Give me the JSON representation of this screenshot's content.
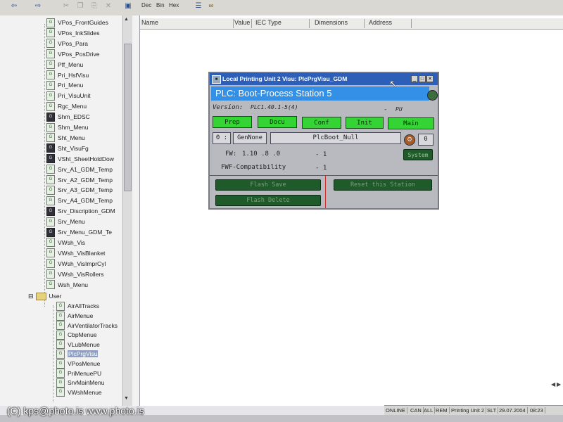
{
  "toolbar": {
    "dec": "Dec",
    "bin": "Bin",
    "hex": "Hex"
  },
  "tree": {
    "items": [
      {
        "label": "VPos_FrontGuides",
        "icon": "visu-icon"
      },
      {
        "label": "VPos_InkSlides",
        "icon": "visu-icon"
      },
      {
        "label": "VPos_Para",
        "icon": "visu-icon"
      },
      {
        "label": "VPos_PosDrive",
        "icon": "visu-icon"
      },
      {
        "label": "Pff_Menu",
        "icon": "visu-icon"
      },
      {
        "label": "Pri_HsfVisu",
        "icon": "visu-icon"
      },
      {
        "label": "Pri_Menu",
        "icon": "visu-icon"
      },
      {
        "label": "Pri_VisuUnit",
        "icon": "visu-icon"
      },
      {
        "label": "Rgc_Menu",
        "icon": "visu-icon"
      },
      {
        "label": "Shm_EDSC",
        "icon": "visu-dark-icon"
      },
      {
        "label": "Shm_Menu",
        "icon": "visu-icon"
      },
      {
        "label": "Sht_Menu",
        "icon": "visu-icon"
      },
      {
        "label": "Sht_VisuFg",
        "icon": "visu-dark-icon"
      },
      {
        "label": "VSht_SheetHoldDow",
        "icon": "visu-dark-icon"
      },
      {
        "label": "Srv_A1_GDM_Temp",
        "icon": "visu-icon"
      },
      {
        "label": "Srv_A2_GDM_Temp",
        "icon": "visu-icon"
      },
      {
        "label": "Srv_A3_GDM_Temp",
        "icon": "visu-icon"
      },
      {
        "label": "Srv_A4_GDM_Temp",
        "icon": "visu-icon"
      },
      {
        "label": "Srv_Discription_GDM",
        "icon": "visu-dark-icon"
      },
      {
        "label": "Srv_Menu",
        "icon": "visu-icon"
      },
      {
        "label": "Srv_Menu_GDM_Te",
        "icon": "visu-dark-icon"
      },
      {
        "label": "VWsh_Vis",
        "icon": "visu-icon"
      },
      {
        "label": "VWsh_VisBlanket",
        "icon": "visu-icon"
      },
      {
        "label": "VWsh_VisImprCyl",
        "icon": "visu-icon"
      },
      {
        "label": "VWsh_VisRollers",
        "icon": "visu-icon"
      },
      {
        "label": "Wsh_Menu",
        "icon": "visu-icon"
      }
    ],
    "folder": {
      "label": "User",
      "icon": "folder-icon"
    },
    "user_items": [
      {
        "label": "AirAllTracks"
      },
      {
        "label": "AirMenue"
      },
      {
        "label": "AirVentilatorTracks"
      },
      {
        "label": "CbpMenue"
      },
      {
        "label": "VLubMenue"
      },
      {
        "label": "PlcPrgVisu",
        "selected": true
      },
      {
        "label": "VPosMenue"
      },
      {
        "label": "PriMenuePU"
      },
      {
        "label": "SrvMainMenu"
      },
      {
        "label": "VWshMenue"
      }
    ]
  },
  "columns": {
    "name": "Name",
    "value": "Value",
    "iec_type": "IEC Type",
    "dimensions": "Dimensions",
    "address": "Address"
  },
  "dialog": {
    "title": "Local Printing Unit 2 Visu: PlcPrgVisu_GDM",
    "header": "PLC: Boot-Process  Station 5",
    "version_label": "Version:",
    "version_value": "PLC1.40.1-5(4)",
    "version_dash": "-",
    "version_suffix": "PU",
    "buttons": {
      "prep": "Prep",
      "docu": "Docu",
      "conf": "Conf",
      "init": "Init",
      "main": "Main"
    },
    "num_left": "0 :",
    "gen": "GenNone",
    "boot": "PlcBoot_Null",
    "num_right": "0",
    "fw_label": "FW:",
    "fw_value": "1.10  .8   .0",
    "fw_dash": "- 1",
    "fwf_label": "FWF-Compatibility",
    "fwf_dash": "- 1",
    "system_button": "System",
    "flash_save": "Flash Save",
    "reset_station": "Reset this Station",
    "flash_delete": "Flash Delete"
  },
  "status": {
    "online": "ONLINE",
    "can": "CAN",
    "all": "ALL",
    "rem": "REM",
    "unit": "Printing Unit 2",
    "slt": "SLT",
    "date": "29.07.2004",
    "time": "08:23"
  },
  "watermark": "(C) kps@photo.is  www.photo.is",
  "colors": {
    "title_bar": "#2e5fb8",
    "plc_bar": "#3390e6",
    "green_button": "#33d433",
    "dark_green_button": "#1f5a2a",
    "separator_red": "#d02a2a"
  }
}
